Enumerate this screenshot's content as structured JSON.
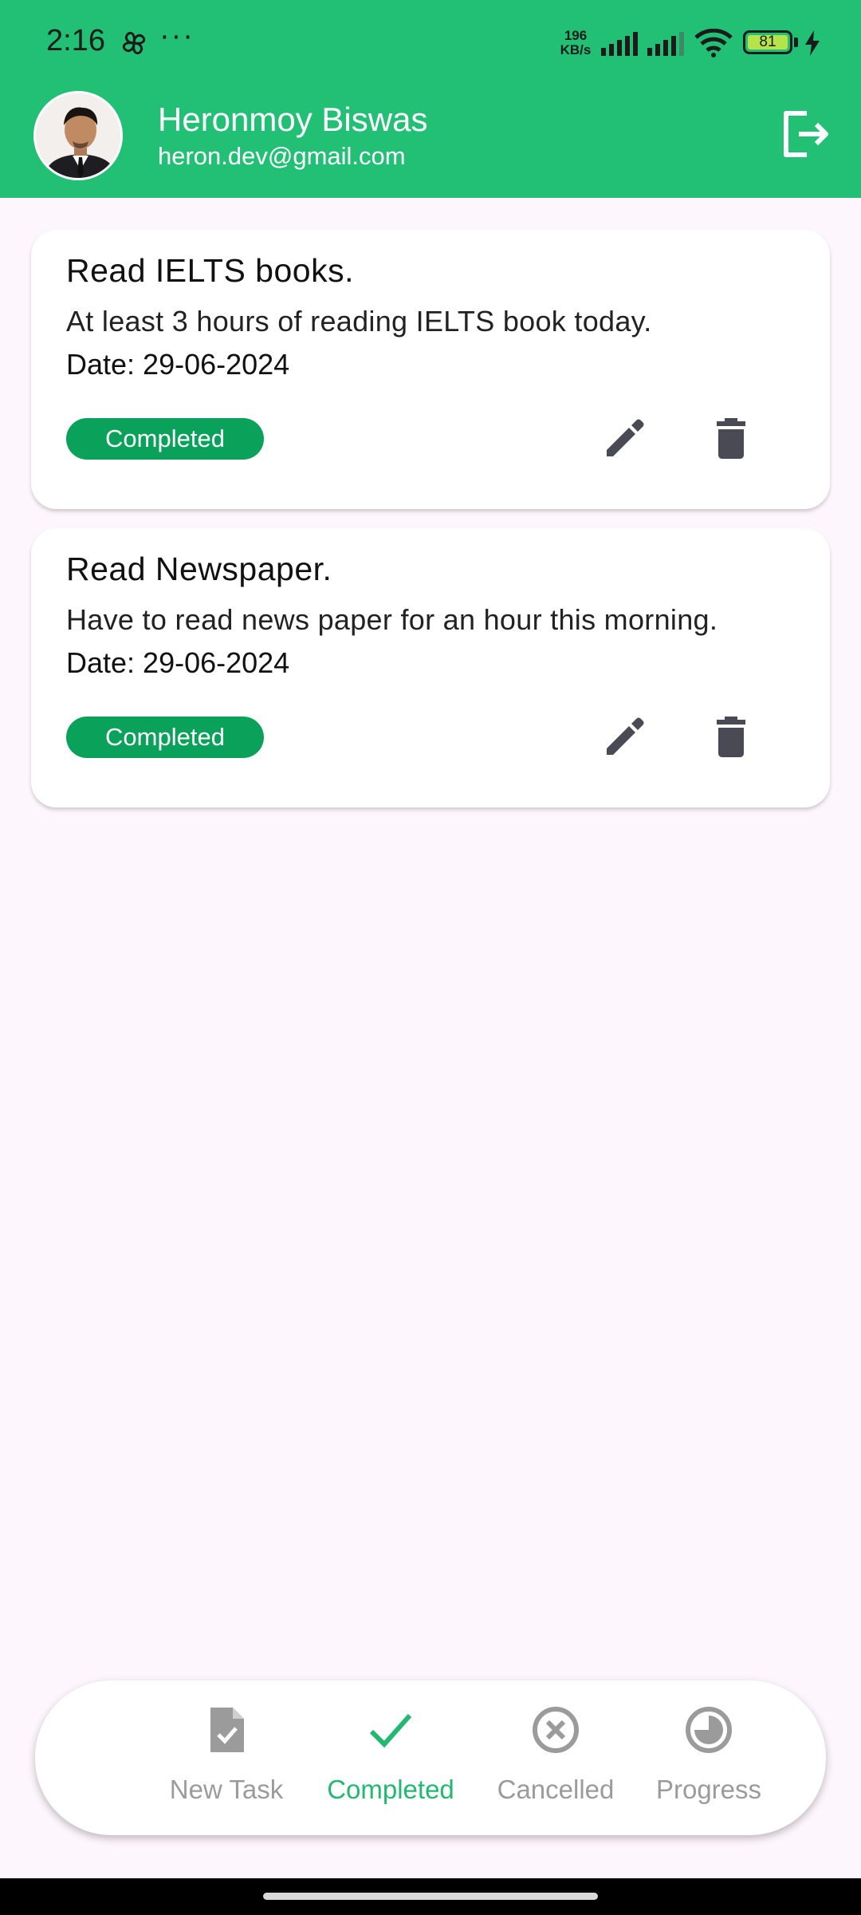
{
  "status_bar": {
    "time": "2:16",
    "dots": "···",
    "net_speed_value": "196",
    "net_speed_unit": "KB/s",
    "battery": "81"
  },
  "header": {
    "user_name": "Heronmoy Biswas",
    "user_email": "heron.dev@gmail.com",
    "logout_icon": "logout-icon",
    "background_color": "#22c074"
  },
  "tasks": [
    {
      "title": "Read IELTS books.",
      "description": "At least 3 hours of reading IELTS book today.",
      "date": "Date: 29-06-2024",
      "status": "Completed"
    },
    {
      "title": "Read Newspaper.",
      "description": "Have to read news paper for an hour this morning.",
      "date": "Date: 29-06-2024",
      "status": "Completed"
    }
  ],
  "colors": {
    "badge": "#0aa25a",
    "active_tab": "#22b872",
    "inactive_tab": "#9b9b9b",
    "page_bg": "#fdf6fc"
  },
  "bottom_nav": {
    "items": [
      {
        "label": "New Task",
        "icon": "task-document-icon",
        "active": false
      },
      {
        "label": "Completed",
        "icon": "checkmark-icon",
        "active": true
      },
      {
        "label": "Cancelled",
        "icon": "cancel-circle-icon",
        "active": false
      },
      {
        "label": "Progress",
        "icon": "progress-pie-icon",
        "active": false
      }
    ]
  }
}
